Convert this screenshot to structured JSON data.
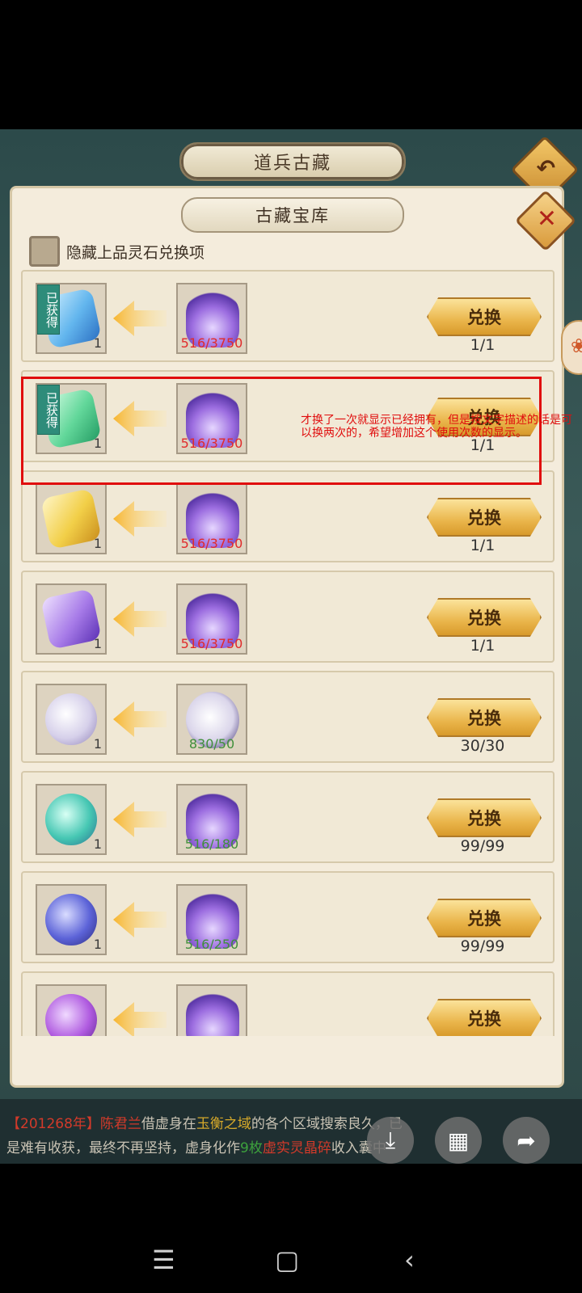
{
  "header": {
    "outer_title": "道兵古藏",
    "inner_title": "古藏宝库"
  },
  "controls": {
    "back_icon": "↶",
    "close_icon": "✕"
  },
  "hide_option": {
    "label": "隐藏上品灵石兑换项",
    "checked": false
  },
  "owned_tag": "已获得",
  "exchange_label": "兑换",
  "rows": [
    {
      "reward_icon": "blue-gem-icon",
      "reward_qty": "1",
      "owned": true,
      "cost": "516/3750",
      "cost_color": "red",
      "count": "1/1"
    },
    {
      "reward_icon": "green-gem-icon",
      "reward_qty": "1",
      "owned": true,
      "cost": "516/3750",
      "cost_color": "red",
      "count": "1/1"
    },
    {
      "reward_icon": "yellow-gem-icon",
      "reward_qty": "1",
      "owned": false,
      "cost": "516/3750",
      "cost_color": "red",
      "count": "1/1"
    },
    {
      "reward_icon": "purple-gem-icon",
      "reward_qty": "1",
      "owned": false,
      "cost": "516/3750",
      "cost_color": "red",
      "count": "1/1"
    },
    {
      "reward_icon": "white-taiji-orb-icon",
      "reward_qty": "1",
      "owned": false,
      "cost": "830/50",
      "cost_color": "green",
      "count": "30/30"
    },
    {
      "reward_icon": "teal-taiji-orb-icon",
      "reward_qty": "1",
      "owned": false,
      "cost": "516/180",
      "cost_color": "green",
      "count": "99/99"
    },
    {
      "reward_icon": "indigo-taiji-orb-icon",
      "reward_qty": "1",
      "owned": false,
      "cost": "516/250",
      "cost_color": "green",
      "count": "99/99"
    },
    {
      "reward_icon": "purple-orb-icon",
      "reward_qty": "",
      "owned": false,
      "cost": "",
      "cost_color": "red",
      "count": ""
    }
  ],
  "annotation": {
    "text": "才换了一次就显示已经拥有，但是按文字描述的话是可以换两次的，希望增加这个使用次数的显示。",
    "color": "#e00d0d"
  },
  "ticker": {
    "seg1": "【201268年】",
    "seg2": "陈君兰",
    "seg3": "借虚身在",
    "seg4": "玉衡之域",
    "seg5": "的各个区域搜索良久，已是难有收获，最终不再坚持，虚身化作",
    "seg6": "9枚",
    "seg7": "虚实灵晶碎",
    "seg8": "收入囊中"
  },
  "fabs": {
    "download_icon": "⤓",
    "grid_icon": "▦",
    "share_icon": "➦"
  },
  "system_nav": {
    "menu_icon": "☰",
    "home_icon": "▢",
    "back_icon": "‹"
  },
  "colors": {
    "cost_red": "#e12a2a",
    "cost_green": "#3f8f3a",
    "button_gold": "#eab64c"
  }
}
